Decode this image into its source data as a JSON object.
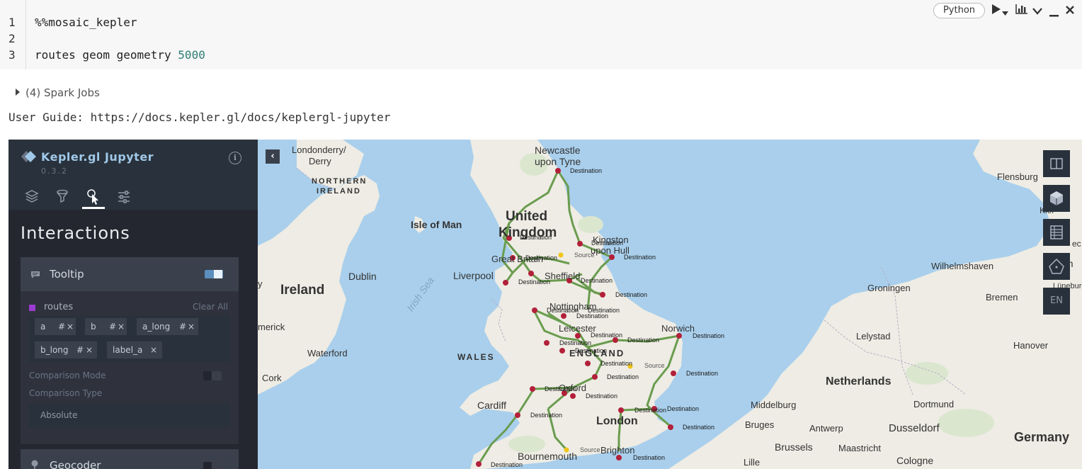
{
  "cell": {
    "line_numbers": [
      "1",
      "2",
      "3"
    ],
    "line1": "%%mosaic_kepler",
    "line2": "",
    "line3_code": "routes geom geometry ",
    "line3_number": "5000",
    "language": "Python",
    "tools": [
      "run-icon",
      "chevron-down-icon",
      "chart-icon",
      "expand-icon",
      "minimize-icon",
      "close-icon"
    ]
  },
  "output": {
    "spark_jobs": "(4) Spark Jobs",
    "user_guide": "User Guide: https://docs.kepler.gl/docs/keplergl-jupyter"
  },
  "kepler": {
    "title": "Kepler.gl Jupyter",
    "version": "0.3.2",
    "tabs": [
      "layers-icon",
      "filter-icon",
      "interactions-icon",
      "settings-icon"
    ],
    "active_tab": "interactions-icon",
    "panel_title": "Interactions",
    "tooltip": {
      "label": "Tooltip",
      "enabled": true,
      "layer": "routes",
      "clear_all": "Clear All",
      "fields": [
        "a",
        "b",
        "a_long",
        "b_long",
        "label_a"
      ],
      "field_hash": "#",
      "field_x": "×",
      "comparison_mode": "Comparison Mode",
      "comparison_type": "Comparison Type",
      "comparison_value": "Absolute"
    },
    "geocoder": {
      "label": "Geocoder",
      "enabled": false
    },
    "colors": {
      "route": "#6a9c4f",
      "point": "#b3203a",
      "source": "#f0c419",
      "water": "#a9cfec",
      "land": "#eeece4",
      "panel": "#242730"
    }
  },
  "map": {
    "collapse_label": "‹",
    "controls": [
      "split-map-icon",
      "3d-map-icon",
      "data-table-icon",
      "draw-icon"
    ],
    "language_button": "EN",
    "place_labels": {
      "londonderry": "Londonderry/",
      "derry": "Derry",
      "northern": "NORTHERN",
      "ireland_region": "IRELAND",
      "newcastle": "Newcastle",
      "upon_tyne": "upon Tyne",
      "isle_of_man": "Isle of Man",
      "united": "United",
      "kingdom": "Kingdom",
      "kingston": "Kingston",
      "upon_hull": "upon Hull",
      "great_britain": "Great Britain",
      "dublin": "Dublin",
      "liverpool": "Liverpool",
      "sheffield": "Sheffield",
      "irish_sea": "Irish Sea",
      "ireland": "Ireland",
      "merick": "merick",
      "nottingham": "Nottingham",
      "leicester": "Leicester",
      "norwich": "Norwich",
      "england": "ENGLAND",
      "wales": "WALES",
      "waterford": "Waterford",
      "cork": "Cork",
      "oxford": "Oxford",
      "cardiff": "Cardiff",
      "london": "London",
      "bournemouth": "Bournemouth",
      "brighton": "Brighton",
      "flensburg": "Flensburg",
      "kiel": "Kiel",
      "wilhelmshaven": "Wilhelmshaven",
      "hamburg": "Ham",
      "luneburg": "Lüneburg",
      "groningen": "Groningen",
      "bremen": "Bremen",
      "lelystad": "Lelystad",
      "hanover": "Hanover",
      "netherlands": "Netherlands",
      "middelburg": "Middelburg",
      "dortmund": "Dortmund",
      "antwerp": "Antwerp",
      "bruges": "Bruges",
      "dusseldorf": "Dusseldorf",
      "brussels": "Brussels",
      "maastricht": "Maastricht",
      "germany": "Germany",
      "lille": "Lille",
      "cologne": "Cologne",
      "ec": "ec",
      "y": "y"
    },
    "destination": "Destination",
    "source": "Source"
  }
}
